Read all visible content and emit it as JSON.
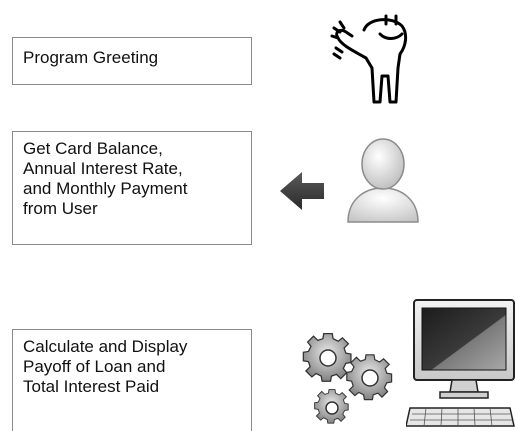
{
  "steps": [
    {
      "text": "Program Greeting"
    },
    {
      "text": "Get Card Balance,\nAnnual Interest Rate,\nand Monthly Payment\nfrom User"
    },
    {
      "text": "Calculate and Display\nPayoff of Loan and\nTotal Interest Paid"
    }
  ],
  "icons": {
    "greeting": "waving-stick-figure-icon",
    "input_arrow": "left-arrow-icon",
    "user": "user-silhouette-icon",
    "process": "gears-icon",
    "display": "computer-monitor-icon"
  },
  "colors": {
    "box_border": "#8a8a8a",
    "icon_dark": "#3a3a3a",
    "icon_light": "#d8d8d8"
  }
}
